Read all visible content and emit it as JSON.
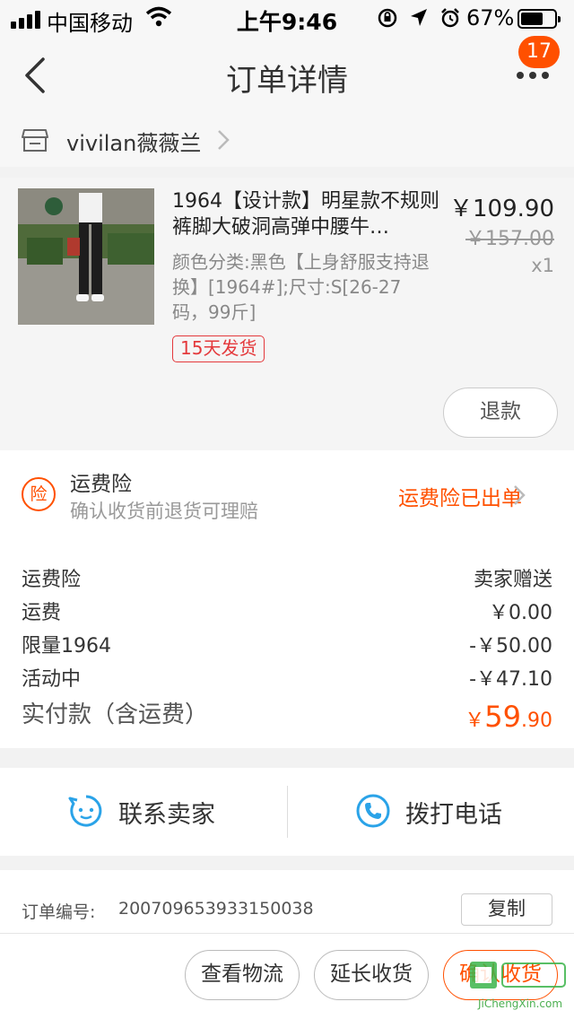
{
  "status_bar": {
    "carrier": "中国移动",
    "time": "上午9:46",
    "battery_percent": "67%",
    "battery_level": 0.67
  },
  "nav": {
    "title": "订单详情",
    "badge_count": "17"
  },
  "shop": {
    "name": "vivilan薇薇兰"
  },
  "item": {
    "title": "1964【设计款】明星款不规则裤脚大破洞高弹中腰牛…",
    "sku": "颜色分类:黑色【上身舒服支持退换】[1964#];尺寸:S[26-27码，99斤]",
    "price": "￥109.90",
    "original_price": "￥157.00",
    "quantity": "x1",
    "shipping_tag": "15天发货",
    "refund_label": "退款"
  },
  "insurance": {
    "icon_char": "险",
    "title": "运费险",
    "subtitle": "确认收货前退货可理赔",
    "status": "运费险已出单"
  },
  "fees": {
    "rows": [
      {
        "label": "运费险",
        "value": "卖家赠送"
      },
      {
        "label": "运费",
        "value": "￥0.00"
      },
      {
        "label": "限量1964",
        "value": "-￥50.00"
      },
      {
        "label": "活动中",
        "value": "-￥47.10"
      }
    ],
    "total_label": "实付款（含运费）",
    "total_currency": "￥",
    "total_int": "59",
    "total_dec": ".90"
  },
  "contact": {
    "seller_label": "联系卖家",
    "call_label": "拨打电话"
  },
  "order": {
    "number_label": "订单编号:",
    "number": "2007096539331500​38",
    "copy_label": "复制"
  },
  "actions": {
    "logistics_label": "查看物流",
    "extend_label": "延长收货",
    "confirm_label": "确认收货"
  },
  "watermark": {
    "text": "JiChengXin.com"
  },
  "colors": {
    "accent": "#ff5000",
    "tag_red": "#e4393c",
    "icon_blue": "#2aa3e8"
  }
}
